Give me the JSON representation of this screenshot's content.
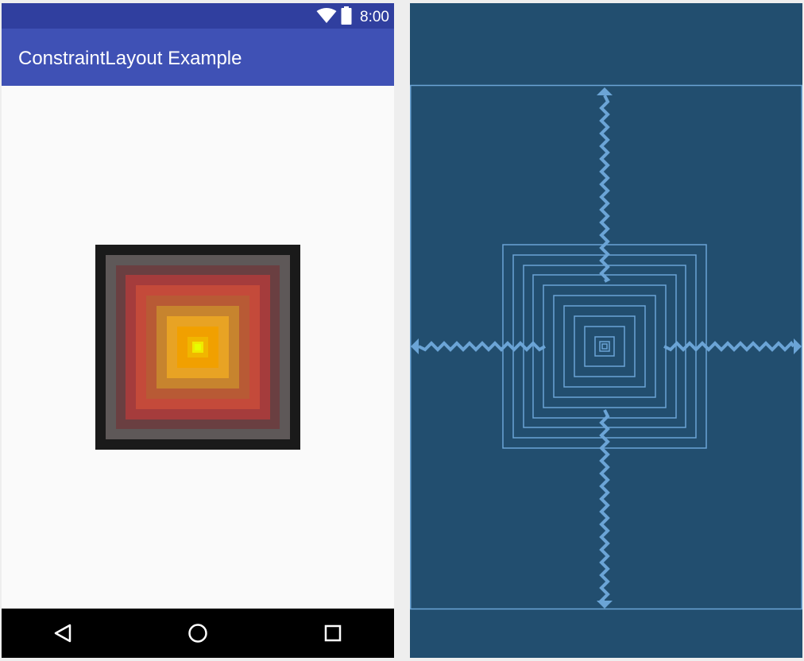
{
  "status_bar": {
    "time": "8:00",
    "wifi_icon": "wifi-icon",
    "battery_icon": "battery-icon"
  },
  "app_bar": {
    "title": "ConstraintLayout Example"
  },
  "nav_bar": {
    "back_icon": "back-triangle-icon",
    "home_icon": "home-circle-icon",
    "recents_icon": "recents-square-icon"
  },
  "colors": {
    "status_bar": "#303f9f",
    "app_bar": "#3f51b5",
    "content_bg": "#fafafa",
    "nav_bar": "#000000",
    "blueprint_bg": "#224e6f",
    "blueprint_line": "#6ba4d6",
    "square_colors": [
      "#1a1a1a",
      "#5e5858",
      "#6a3f41",
      "#a53c3c",
      "#c44a3a",
      "#c7842e",
      "#e8a324",
      "#f1b600",
      "#f5d300",
      "#f0e800",
      "#e6ff00"
    ]
  }
}
